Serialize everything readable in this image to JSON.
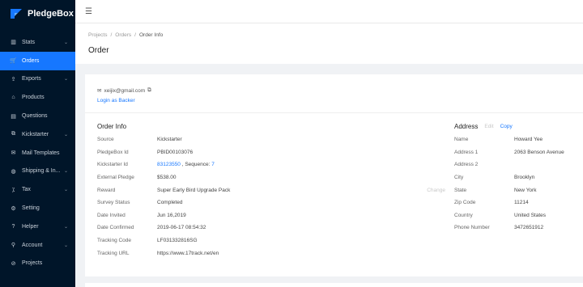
{
  "brand": {
    "name": "PledgeBox",
    "accent": "#1677ff",
    "sidebar_bg": "#001529"
  },
  "sidebar": {
    "items": [
      {
        "label": "Stats",
        "icon": "bar-chart-icon",
        "glyph": "▥",
        "has_children": true,
        "active": false
      },
      {
        "label": "Orders",
        "icon": "cart-icon",
        "glyph": "🛒",
        "has_children": false,
        "active": true
      },
      {
        "label": "Exports",
        "icon": "export-icon",
        "glyph": "⇪",
        "has_children": true,
        "active": false
      },
      {
        "label": "Products",
        "icon": "gift-icon",
        "glyph": "⌂",
        "has_children": false,
        "active": false
      },
      {
        "label": "Questions",
        "icon": "question-icon",
        "glyph": "▤",
        "has_children": false,
        "active": false
      },
      {
        "label": "Kickstarter",
        "icon": "kickstarter-icon",
        "glyph": "⧉",
        "has_children": true,
        "active": false
      },
      {
        "label": "Mail Templates",
        "icon": "mail-icon",
        "glyph": "✉",
        "has_children": false,
        "active": false
      },
      {
        "label": "Shipping & In...",
        "icon": "globe-icon",
        "glyph": "◍",
        "has_children": true,
        "active": false
      },
      {
        "label": "Tax",
        "icon": "tax-icon",
        "glyph": "⁒",
        "has_children": true,
        "active": false
      },
      {
        "label": "Setting",
        "icon": "gear-icon",
        "glyph": "⚙",
        "has_children": false,
        "active": false
      },
      {
        "label": "Helper",
        "icon": "help-icon",
        "glyph": "?",
        "has_children": true,
        "active": false
      },
      {
        "label": "Account",
        "icon": "account-icon",
        "glyph": "⚲",
        "has_children": true,
        "active": false
      },
      {
        "label": "Projects",
        "icon": "projects-icon",
        "glyph": "⊘",
        "has_children": false,
        "active": false
      }
    ]
  },
  "breadcrumb": {
    "items": [
      "Projects",
      "Orders"
    ],
    "current": "Order Info",
    "separator": "/"
  },
  "page": {
    "title": "Order"
  },
  "contact": {
    "email": "xeijix@gmail.com",
    "login_label": "Login as Backer"
  },
  "order_info": {
    "title": "Order Info",
    "source": {
      "label": "Source",
      "value": "Kickstarter"
    },
    "pledgebox_id": {
      "label": "PledgeBox Id",
      "value": "PBID00103076"
    },
    "kickstarter_id": {
      "label": "Kickstarter Id",
      "value": "83123550",
      "sequence_label": ", Sequence:",
      "sequence": "7"
    },
    "external_pledge": {
      "label": "External Pledge",
      "value": "$538.00"
    },
    "reward": {
      "label": "Reward",
      "value": "Super Early Bird Upgrade Pack",
      "change_label": "Change"
    },
    "survey_status": {
      "label": "Survey Status",
      "value": "Completed"
    },
    "date_invited": {
      "label": "Date Invited",
      "value": "Jun 16,2019"
    },
    "date_confirmed": {
      "label": "Date Confirmed",
      "value": "2019-06-17 08:54:32"
    },
    "tracking_code": {
      "label": "Tracking Code",
      "value": "LF031332816SG"
    },
    "tracking_url": {
      "label": "Tracking URL",
      "value": "https://www.17track.net/en"
    }
  },
  "address": {
    "title": "Address",
    "edit_label": "Edit",
    "copy_label": "Copy",
    "rows": [
      {
        "label": "Name",
        "value": "Howard Yee"
      },
      {
        "label": "Address 1",
        "value": "2063 Benson Avenue"
      },
      {
        "label": "Address 2",
        "value": ""
      },
      {
        "label": "City",
        "value": "Brooklyn"
      },
      {
        "label": "State",
        "value": "New York"
      },
      {
        "label": "Zip Code",
        "value": "11214"
      },
      {
        "label": "Country",
        "value": "United States"
      },
      {
        "label": "Phone Number",
        "value": "3472651912"
      }
    ]
  }
}
